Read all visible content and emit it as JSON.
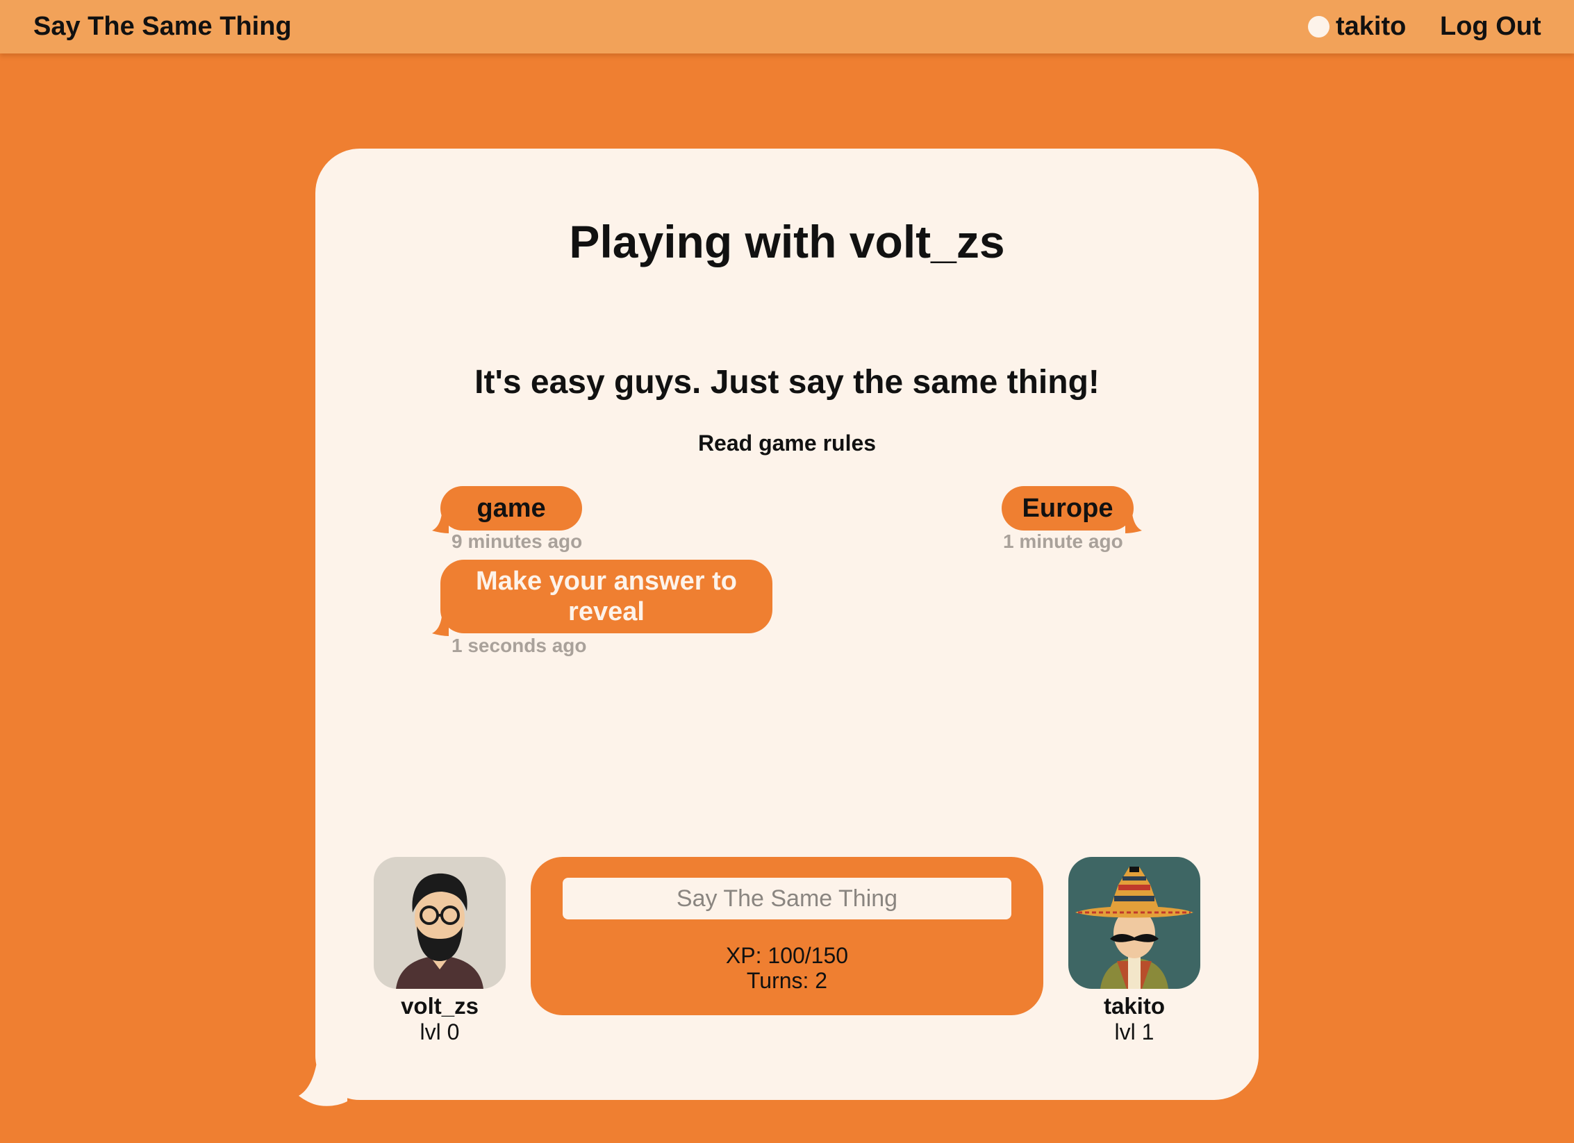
{
  "nav": {
    "brand": "Say The Same Thing",
    "username": "takito",
    "logout_label": "Log Out"
  },
  "game": {
    "title": "Playing with volt_zs",
    "subtitle": "It's easy guys. Just say the same thing!",
    "rules_link": "Read game rules"
  },
  "messages": {
    "left": [
      {
        "text": "game",
        "time": "9 minutes ago"
      },
      {
        "text": "Make your answer to reveal",
        "time": "1 seconds ago"
      }
    ],
    "right": [
      {
        "text": "Europe",
        "time": "1 minute ago"
      }
    ]
  },
  "players": {
    "opponent": {
      "name": "volt_zs",
      "level": "lvl 0"
    },
    "me": {
      "name": "takito",
      "level": "lvl 1"
    }
  },
  "answer": {
    "placeholder": "Say The Same Thing",
    "value": ""
  },
  "stats": {
    "xp": "XP: 100/150",
    "turns": "Turns: 2"
  },
  "colors": {
    "background": "#ef7f31",
    "topbar": "#f2a259",
    "card": "#fdf3ea",
    "bubble": "#ef7f31",
    "timestamp": "#a9a19a"
  }
}
